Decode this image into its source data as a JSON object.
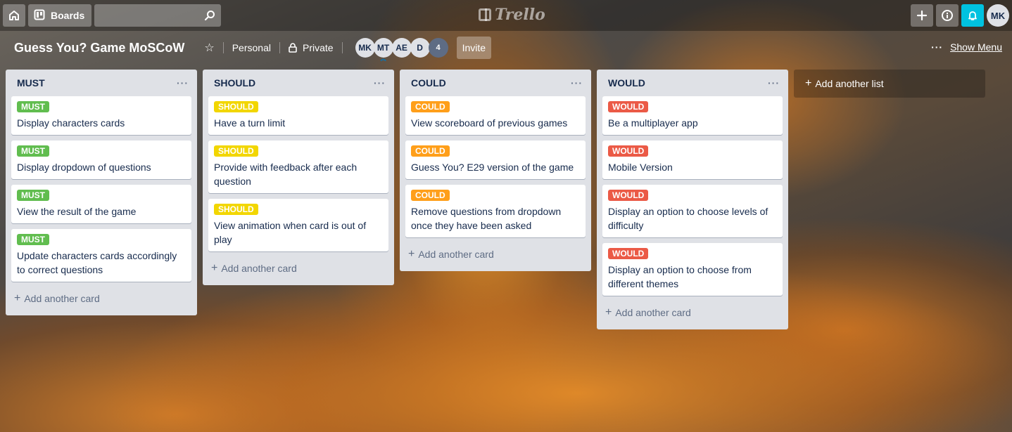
{
  "topbar": {
    "boards_label": "Boards",
    "search_value": "",
    "logo_text": "Trello",
    "user_initials": "MK"
  },
  "board": {
    "title": "Guess You? Game MoSCoW",
    "team": "Personal",
    "visibility": "Private",
    "members": [
      "MK",
      "MT",
      "AE",
      "D"
    ],
    "member_count": "4",
    "invite_label": "Invite",
    "show_menu_label": "Show Menu"
  },
  "labels": {
    "must": {
      "text": "MUST",
      "color": "#61bd4f"
    },
    "should": {
      "text": "SHOULD",
      "color": "#f2d600"
    },
    "could": {
      "text": "COULD",
      "color": "#ff9f1a"
    },
    "would": {
      "text": "WOULD",
      "color": "#eb5a46"
    }
  },
  "lists": [
    {
      "title": "MUST",
      "cards": [
        "Display characters cards",
        "Display dropdown of questions",
        "View the result of the game",
        "Update characters cards accordingly to correct questions"
      ],
      "add_card": "Add another card"
    },
    {
      "title": "SHOULD",
      "cards": [
        "Have a turn limit",
        "Provide with feedback after each question",
        "View animation when card is out of play"
      ],
      "add_card": "Add another card"
    },
    {
      "title": "COULD",
      "cards": [
        "View scoreboard of previous games",
        "Guess You? E29 version of the game",
        "Remove questions from dropdown once they have been asked"
      ],
      "add_card": "Add another card"
    },
    {
      "title": "WOULD",
      "cards": [
        "Be a multiplayer app",
        "Mobile Version",
        "Display an option to choose levels of difficulty",
        "Display an option to choose from different themes"
      ],
      "add_card": "Add another card"
    }
  ],
  "add_list_label": "Add another list"
}
